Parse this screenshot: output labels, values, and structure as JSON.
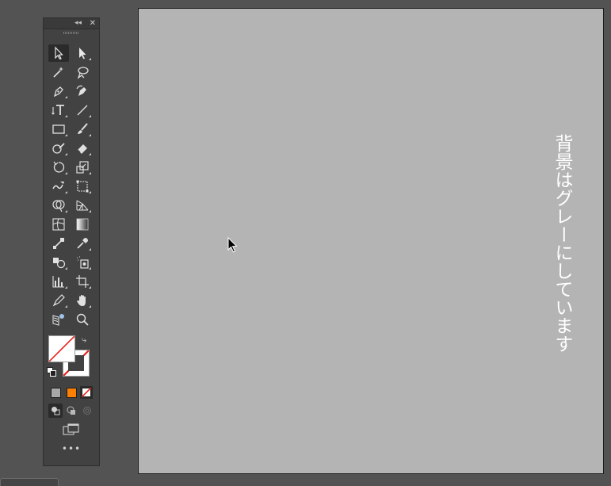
{
  "toolbar": {
    "collapse_icon": "double-chevron-left-icon",
    "close_icon": "close-icon",
    "more_label": "•••"
  },
  "canvas": {
    "text": "背景はグレーにしています",
    "background_color": "#b4b4b4"
  },
  "colors": {
    "app_background": "#535353",
    "panel_background": "#424242",
    "fill_color": "#ffffff",
    "swatch_gray": "#a8a8a8",
    "swatch_orange": "#ff7f00",
    "none_red": "#e8201c"
  }
}
